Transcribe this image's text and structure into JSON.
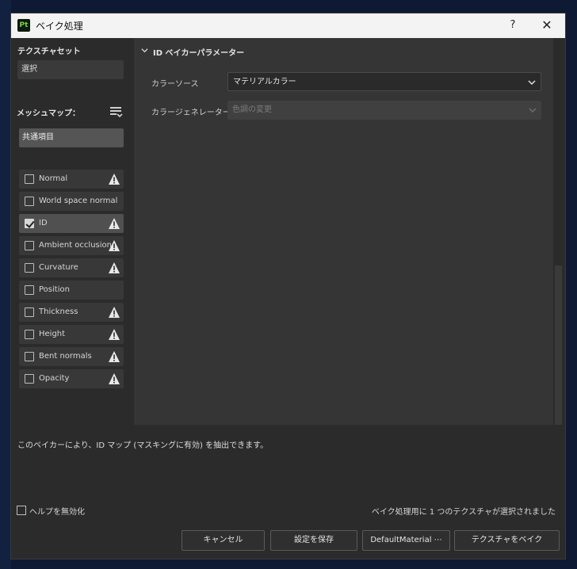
{
  "window": {
    "app_icon": "Pt",
    "title": "ベイク処理",
    "help": "?",
    "close": "✕"
  },
  "sidebar": {
    "texture_set_title": "テクスチャセット",
    "texture_set_value": "選択",
    "mesh_maps_title": "メッシュマップ：",
    "common_tab": "共通項目",
    "maps": [
      {
        "label": "Normal",
        "checked": false,
        "warning": true
      },
      {
        "label": "World space normal",
        "checked": false,
        "warning": false
      },
      {
        "label": "ID",
        "checked": true,
        "warning": true
      },
      {
        "label": "Ambient occlusion",
        "checked": false,
        "warning": true
      },
      {
        "label": "Curvature",
        "checked": false,
        "warning": true
      },
      {
        "label": "Position",
        "checked": false,
        "warning": false
      },
      {
        "label": "Thickness",
        "checked": false,
        "warning": true
      },
      {
        "label": "Height",
        "checked": false,
        "warning": true
      },
      {
        "label": "Bent normals",
        "checked": false,
        "warning": true
      },
      {
        "label": "Opacity",
        "checked": false,
        "warning": true
      }
    ]
  },
  "params": {
    "group_title": "ID ベイカーパラメーター",
    "color_source_label": "カラーソース",
    "color_source_value": "マテリアルカラー",
    "color_generator_label": "カラージェネレーター",
    "color_generator_value": "色調の変更"
  },
  "footer": {
    "description": "このベイカーにより、ID マップ (マスキングに有効) を抽出できます。",
    "disable_help": "ヘルプを無効化",
    "status": "ベイク処理用に 1 つのテクスチャが選択されました",
    "cancel": "キャンセル",
    "save_settings": "設定を保存",
    "default_material": "DefaultMaterial ⋯",
    "bake": "テクスチャをベイク"
  },
  "colors": {
    "accent_icon": "#7bd14a",
    "panel": "#353535",
    "sidebar": "#2b2b2b"
  }
}
